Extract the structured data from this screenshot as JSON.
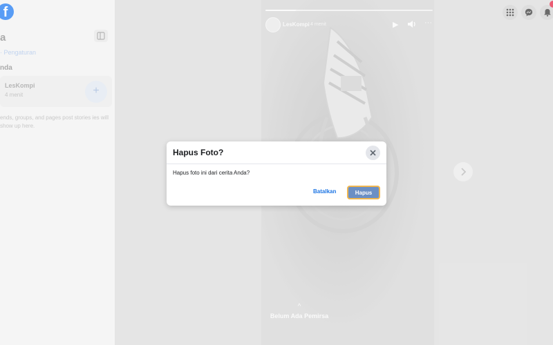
{
  "sidebar": {
    "logo_letter": "f",
    "title": "a",
    "links": "· Pengaturan",
    "section_label": "nda",
    "story": {
      "name": "LesKompi",
      "time": "4 menit",
      "add_symbol": "+"
    },
    "info_text": "ends, groups, and pages post stories ies will show up here."
  },
  "story": {
    "progress": 0.18,
    "author": "LesKompi",
    "time": "4 menit",
    "viewers_caret": "^",
    "viewers_label": "Belum Ada Pemirsa"
  },
  "top_icons": [
    "menu-grid-icon",
    "messenger-icon",
    "bell-icon"
  ],
  "dialog": {
    "title": "Hapus Foto?",
    "body": "Hapus foto ini dari cerita Anda?",
    "cancel_label": "Batalkan",
    "confirm_label": "Hapus"
  },
  "colors": {
    "brand": "#1877f2",
    "link": "#1b74e4",
    "confirm_button": "#6b8fc4",
    "focus_ring": "#f0b64f",
    "notification": "#e41e3f"
  }
}
